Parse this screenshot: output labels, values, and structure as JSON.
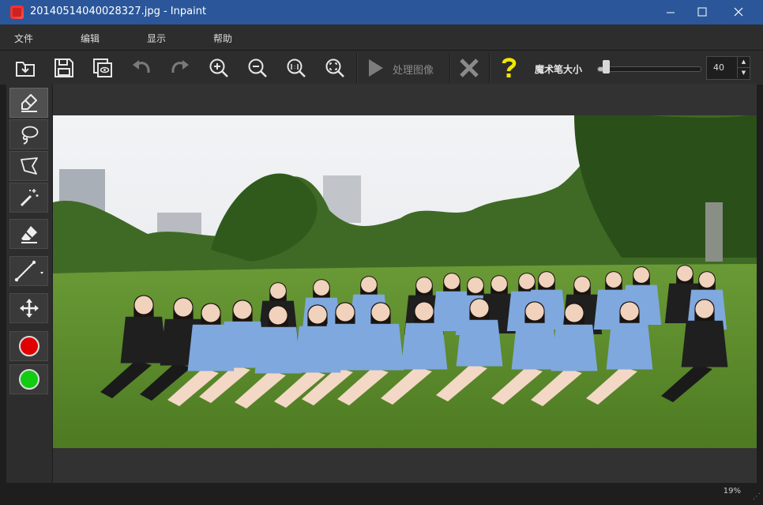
{
  "window": {
    "title": "20140514040028327.jpg - Inpaint",
    "minimize_icon": "minimize-icon",
    "maximize_icon": "maximize-icon",
    "close_icon": "close-icon"
  },
  "menu": {
    "items": [
      {
        "label": "文件"
      },
      {
        "label": "编辑"
      },
      {
        "label": "显示"
      },
      {
        "label": "帮助"
      }
    ]
  },
  "toolbar": {
    "process_label": "处理图像",
    "brush_size_label": "魔术笔大小",
    "brush_size_value": "40",
    "brush_size_fraction": 0.05,
    "icons": [
      "open-icon",
      "save-icon",
      "save-as-icon",
      "undo-icon",
      "redo-icon",
      "zoom-in-icon",
      "zoom-out-icon",
      "actual-size-icon",
      "fit-icon",
      "play-icon",
      "cancel-icon",
      "help-icon"
    ]
  },
  "sidebar": {
    "tools": [
      "marker-icon",
      "lasso-icon",
      "polygon-lasso-icon",
      "magic-wand-icon",
      "eraser-icon",
      "line-icon",
      "move-icon"
    ],
    "colors": {
      "remove": "#e00000",
      "keep": "#11cc11"
    }
  },
  "status": {
    "zoom": "19%"
  },
  "colors": {
    "titlebar": "#2b579a",
    "panel": "#2d2d2d",
    "background": "#1e1e1e"
  }
}
